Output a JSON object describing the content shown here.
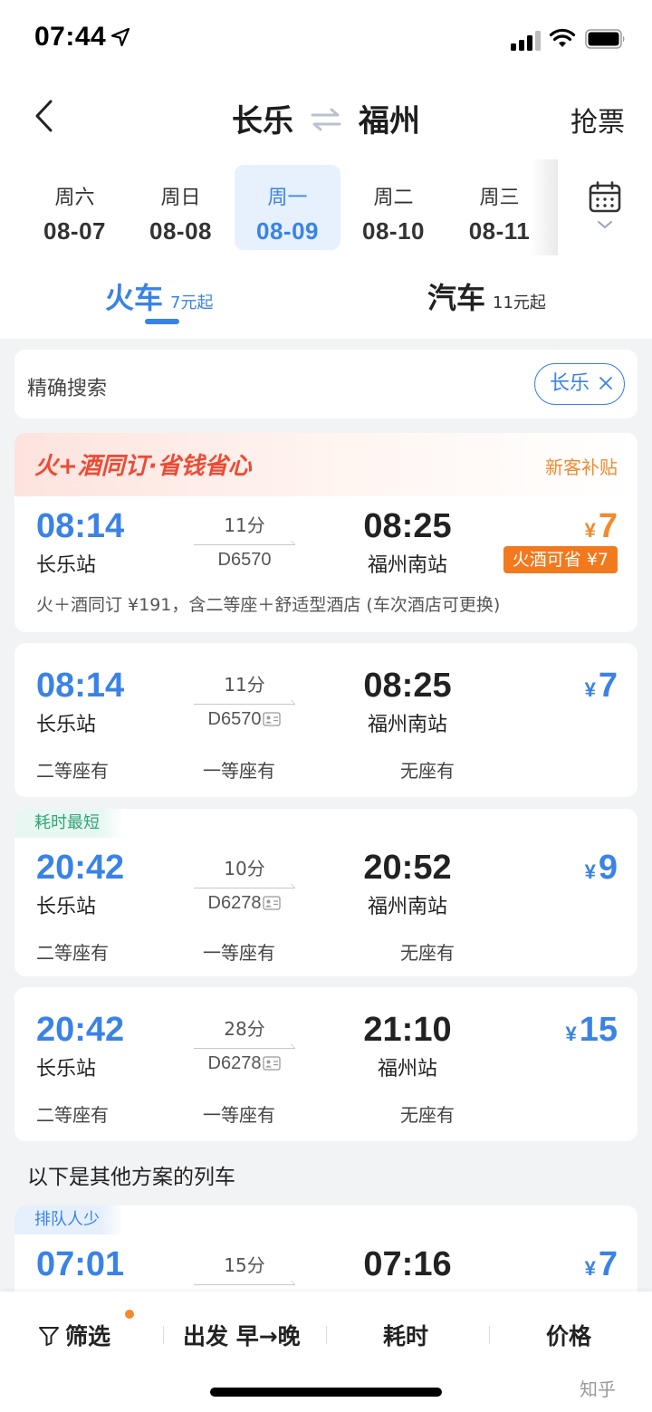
{
  "status_bar": {
    "time": "07:44"
  },
  "nav": {
    "from": "长乐",
    "to": "福州",
    "right_action": "抢票"
  },
  "dates": [
    {
      "weekday": "周六",
      "date": "08-07",
      "active": false
    },
    {
      "weekday": "周日",
      "date": "08-08",
      "active": false
    },
    {
      "weekday": "周一",
      "date": "08-09",
      "active": true
    },
    {
      "weekday": "周二",
      "date": "08-10",
      "active": false
    },
    {
      "weekday": "周三",
      "date": "08-11",
      "active": false
    }
  ],
  "modes": {
    "train": {
      "label": "火车",
      "sub": "7元起"
    },
    "bus": {
      "label": "汽车",
      "sub": "11元起"
    }
  },
  "search": {
    "label": "精确搜索",
    "chip": "长乐"
  },
  "promo": {
    "title": "火+酒同订·省钱省心",
    "right": "新客补贴"
  },
  "trains": [
    {
      "dep": "08:14",
      "from": "长乐站",
      "duration": "11分",
      "train_no": "D6570",
      "arr": "08:25",
      "to": "福州南站",
      "price": "7",
      "save_badge": "火酒可省 ¥7",
      "note": "火＋酒同订 ¥191，含二等座＋舒适型酒店 (车次酒店可更换)"
    },
    {
      "dep": "08:14",
      "from": "长乐站",
      "duration": "11分",
      "train_no": "D6570",
      "arr": "08:25",
      "to": "福州南站",
      "price": "7",
      "seats": [
        "二等座有",
        "一等座有",
        "无座有"
      ]
    },
    {
      "tag": "耗时最短",
      "dep": "20:42",
      "from": "长乐站",
      "duration": "10分",
      "train_no": "D6278",
      "arr": "20:52",
      "to": "福州南站",
      "price": "9",
      "seats": [
        "二等座有",
        "一等座有",
        "无座有"
      ]
    },
    {
      "dep": "20:42",
      "from": "长乐站",
      "duration": "28分",
      "train_no": "D6278",
      "arr": "21:10",
      "to": "福州站",
      "price": "15",
      "seats": [
        "二等座有",
        "一等座有",
        "无座有"
      ]
    }
  ],
  "other_section": "以下是其他方案的列车",
  "other_train": {
    "tag": "排队人少",
    "dep": "07:01",
    "duration": "15分",
    "arr": "07:16",
    "price": "7"
  },
  "currency": "¥",
  "bottom": {
    "filter": "筛选",
    "depart": "出发 早→晚",
    "duration": "耗时",
    "price": "价格"
  },
  "watermark": "知乎"
}
